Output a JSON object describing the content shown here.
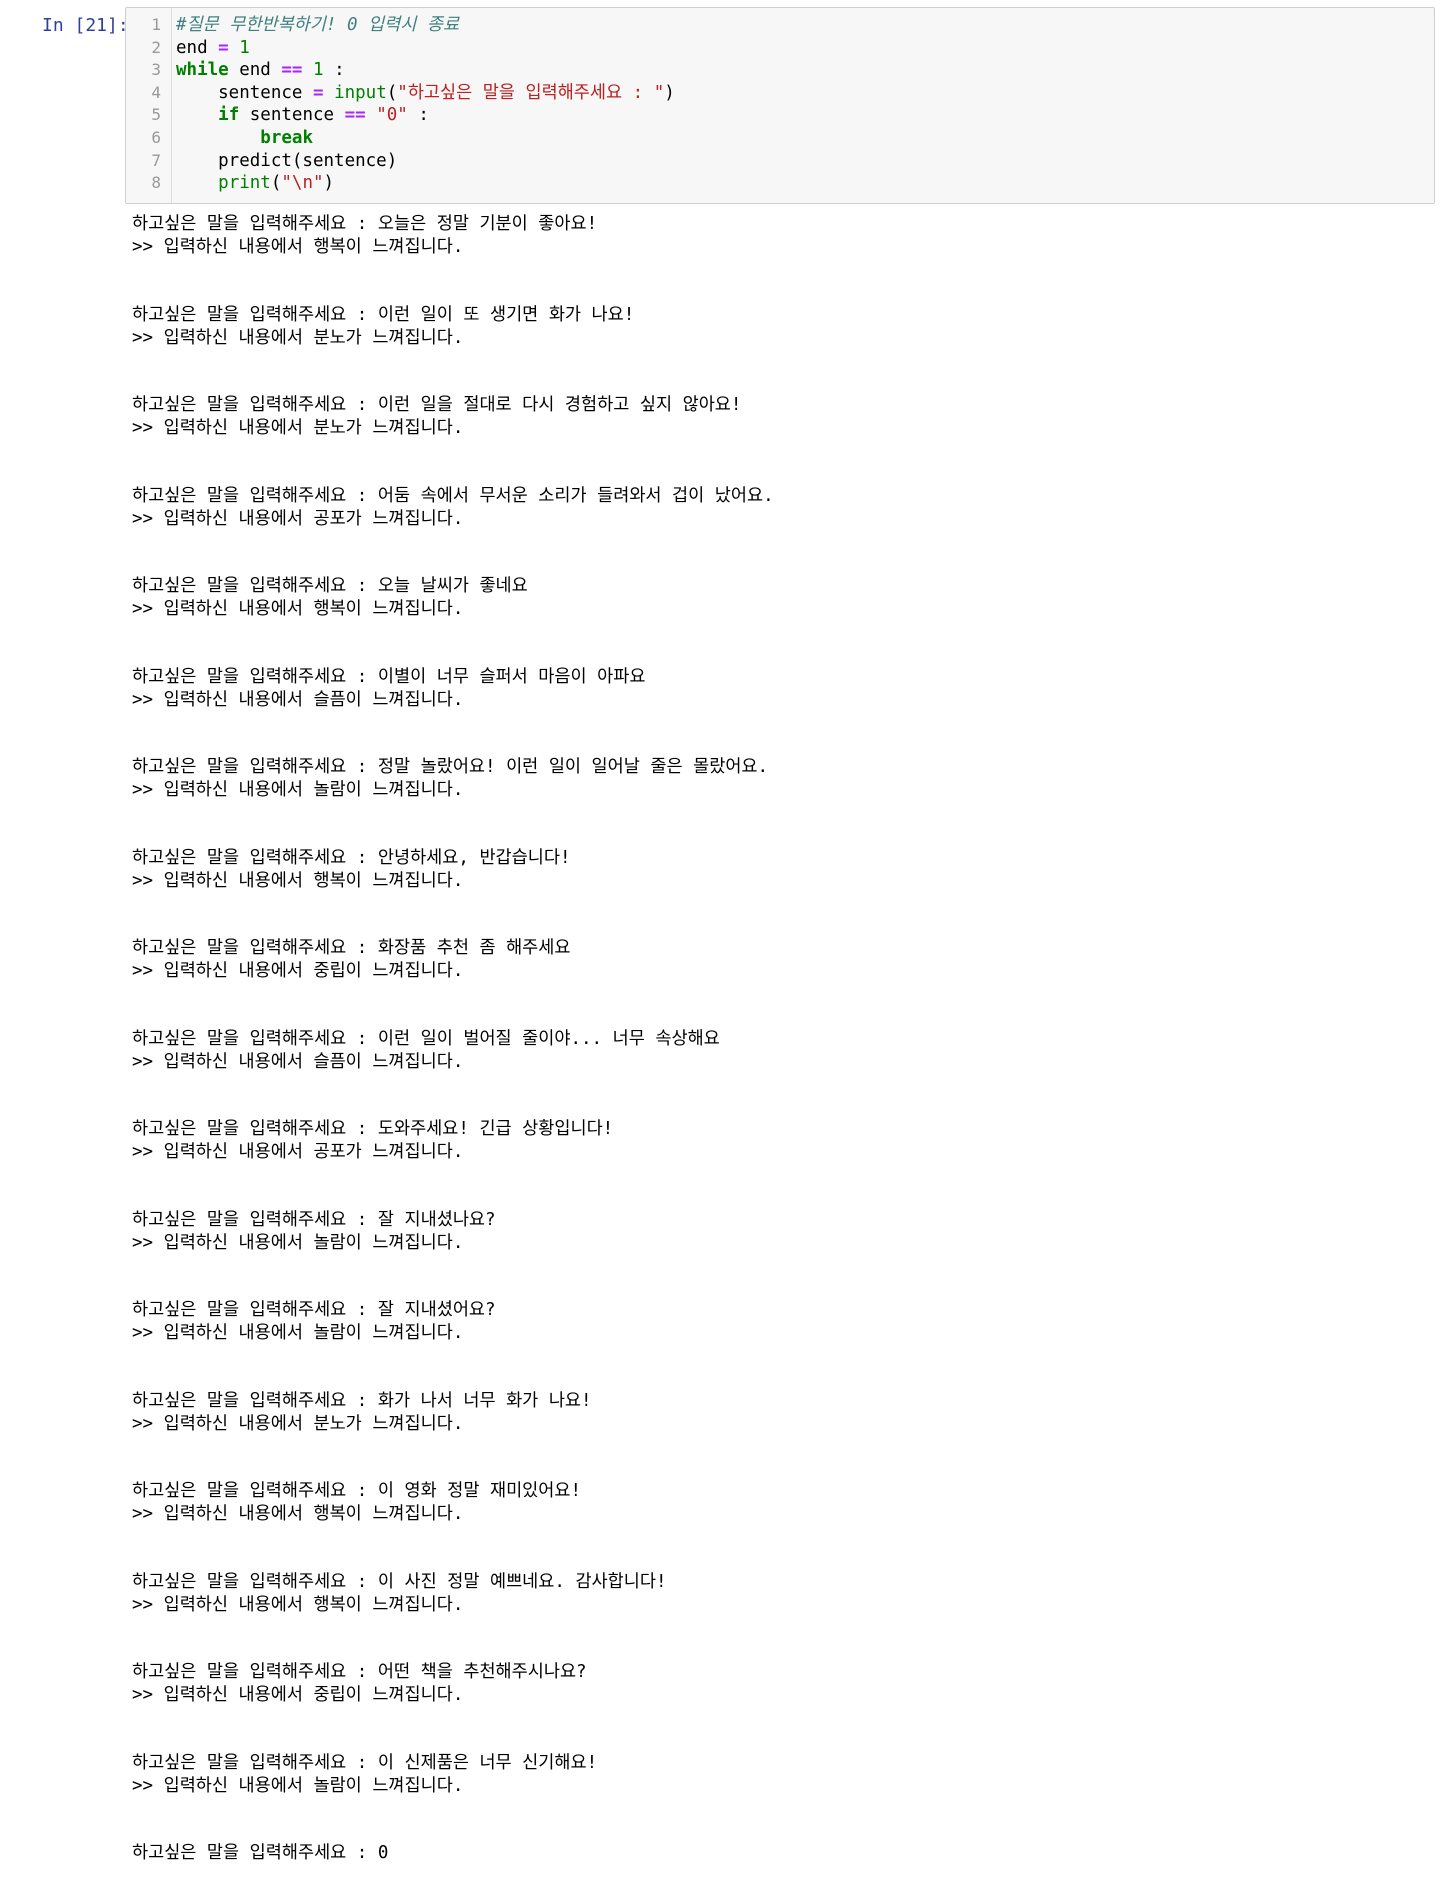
{
  "cell": {
    "prompt": "In [21]:",
    "code_lines": [
      {
        "num": "1",
        "parts": [
          {
            "t": "#질문 무한반복하기! 0 입력시 종료",
            "c": "cm"
          }
        ]
      },
      {
        "num": "2",
        "parts": [
          {
            "t": "end ",
            "c": ""
          },
          {
            "t": "=",
            "c": "op"
          },
          {
            "t": " ",
            "c": ""
          },
          {
            "t": "1",
            "c": "nm"
          }
        ]
      },
      {
        "num": "3",
        "parts": [
          {
            "t": "while",
            "c": "kw"
          },
          {
            "t": " end ",
            "c": ""
          },
          {
            "t": "==",
            "c": "op"
          },
          {
            "t": " ",
            "c": ""
          },
          {
            "t": "1",
            "c": "nm"
          },
          {
            "t": " :",
            "c": ""
          }
        ]
      },
      {
        "num": "4",
        "parts": [
          {
            "t": "    sentence ",
            "c": ""
          },
          {
            "t": "=",
            "c": "op"
          },
          {
            "t": " ",
            "c": ""
          },
          {
            "t": "input",
            "c": "bi"
          },
          {
            "t": "(",
            "c": ""
          },
          {
            "t": "\"하고싶은 말을 입력해주세요 : \"",
            "c": "st"
          },
          {
            "t": ")",
            "c": ""
          }
        ]
      },
      {
        "num": "5",
        "parts": [
          {
            "t": "    ",
            "c": ""
          },
          {
            "t": "if",
            "c": "kw"
          },
          {
            "t": " sentence ",
            "c": ""
          },
          {
            "t": "==",
            "c": "op"
          },
          {
            "t": " ",
            "c": ""
          },
          {
            "t": "\"0\"",
            "c": "st"
          },
          {
            "t": " :",
            "c": ""
          }
        ]
      },
      {
        "num": "6",
        "parts": [
          {
            "t": "        ",
            "c": ""
          },
          {
            "t": "break",
            "c": "kw"
          }
        ]
      },
      {
        "num": "7",
        "parts": [
          {
            "t": "    predict(sentence)",
            "c": ""
          }
        ]
      },
      {
        "num": "8",
        "parts": [
          {
            "t": "    ",
            "c": ""
          },
          {
            "t": "print",
            "c": "bi"
          },
          {
            "t": "(",
            "c": ""
          },
          {
            "t": "\"\\n\"",
            "c": "st"
          },
          {
            "t": ")",
            "c": ""
          }
        ]
      }
    ]
  },
  "output": {
    "prompt_prefix": "하고싶은 말을 입력해주세요 : ",
    "result_prefix": ">> 입력하신 내용에서 ",
    "result_suffix": " 느껴집니다.",
    "entries": [
      {
        "input": "오늘은 정말 기분이 좋아요!",
        "emotion": "행복이"
      },
      {
        "input": "이런 일이 또 생기면 화가 나요!",
        "emotion": "분노가"
      },
      {
        "input": "이런 일을 절대로 다시 경험하고 싶지 않아요!",
        "emotion": "분노가"
      },
      {
        "input": "어둠 속에서 무서운 소리가 들려와서 겁이 났어요.",
        "emotion": "공포가"
      },
      {
        "input": "오늘 날씨가 좋네요",
        "emotion": "행복이"
      },
      {
        "input": "이별이 너무 슬퍼서 마음이 아파요",
        "emotion": "슬픔이"
      },
      {
        "input": "정말 놀랐어요! 이런 일이 일어날 줄은 몰랐어요.",
        "emotion": "놀람이"
      },
      {
        "input": "안녕하세요, 반갑습니다!",
        "emotion": "행복이"
      },
      {
        "input": "화장품 추천 좀 해주세요",
        "emotion": "중립이"
      },
      {
        "input": "이런 일이 벌어질 줄이야... 너무 속상해요",
        "emotion": "슬픔이"
      },
      {
        "input": "도와주세요! 긴급 상황입니다!",
        "emotion": "공포가"
      },
      {
        "input": "잘 지내셨나요?",
        "emotion": "놀람이"
      },
      {
        "input": "잘 지내셨어요?",
        "emotion": "놀람이"
      },
      {
        "input": "화가 나서 너무 화가 나요!",
        "emotion": "분노가"
      },
      {
        "input": "이 영화 정말 재미있어요!",
        "emotion": "행복이"
      },
      {
        "input": "이 사진 정말 예쁘네요. 감사합니다!",
        "emotion": "행복이"
      },
      {
        "input": "어떤 책을 추천해주시나요?",
        "emotion": "중립이"
      },
      {
        "input": "이 신제품은 너무 신기해요!",
        "emotion": "놀람이"
      }
    ],
    "final_input": "0"
  }
}
